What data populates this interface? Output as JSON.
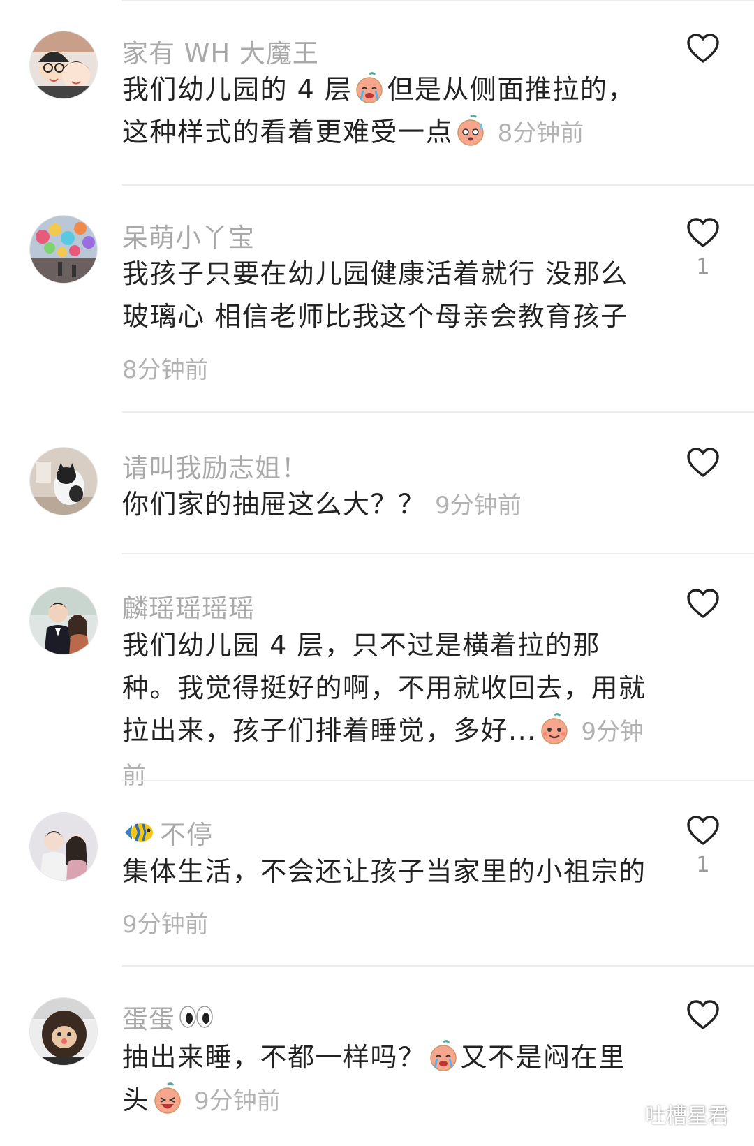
{
  "comments": [
    {
      "username": "家有 WH 大魔王",
      "text_a": "我们幼儿园的 4 层",
      "text_b": "但是从侧面推拉的，这种样式的看着更难受一点",
      "time": "8分钟前",
      "likes": null
    },
    {
      "username": "呆萌小丫宝",
      "text": "我孩子只要在幼儿园健康活着就行  没那么玻璃心   相信老师比我这个母亲会教育孩子",
      "time": "8分钟前",
      "likes": "1"
    },
    {
      "username": "请叫我励志姐！",
      "text": "你们家的抽屉这么大？？",
      "time": "9分钟前",
      "likes": null
    },
    {
      "username": "麟瑶瑶瑶瑶",
      "text": "我们幼儿园 4 层，只不过是横着拉的那种。我觉得挺好的啊，不用就收回去，用就拉出来，孩子们排着睡觉，多好...",
      "time": "9分钟前",
      "likes": null
    },
    {
      "username": "不停",
      "text": "集体生活，不会还让孩子当家里的小祖宗的",
      "time": "9分钟前",
      "likes": "1"
    },
    {
      "username": "蛋蛋",
      "text_a": "抽出来睡，不都一样吗？",
      "text_b": "又不是闷在里头",
      "time": "9分钟前",
      "likes": null
    }
  ],
  "watermark": {
    "text": "吐槽星君"
  },
  "icons": {
    "like": "heart-outline-icon",
    "emoji": [
      "crying-emoji-icon",
      "sweating-emoji-icon",
      "smiling-emoji-icon",
      "crying-emoji-icon",
      "laughing-emoji-icon"
    ],
    "username_decor": [
      "fish-icon",
      "eyes-icon"
    ],
    "watermark": "wechat-icon"
  },
  "colors": {
    "username": "#a9a9a9",
    "text": "#222222",
    "time": "#b2b2b2",
    "divider": "#ececec",
    "emoji": "#f5a08a"
  }
}
